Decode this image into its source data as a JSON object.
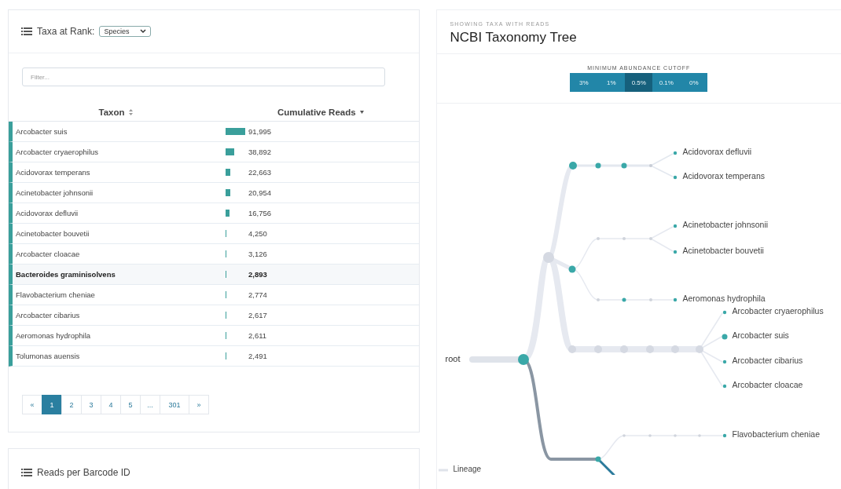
{
  "taxa_panel": {
    "title": "Taxa at Rank:",
    "rank_select": {
      "value": "Species"
    },
    "filter": {
      "placeholder": "Filter..."
    },
    "columns": [
      "Taxon",
      "Cumulative Reads"
    ],
    "rows": [
      {
        "taxon": "Arcobacter suis",
        "reads": "91,995",
        "selected": false
      },
      {
        "taxon": "Arcobacter cryaerophilus",
        "reads": "38,892",
        "selected": false
      },
      {
        "taxon": "Acidovorax temperans",
        "reads": "22,663",
        "selected": false
      },
      {
        "taxon": "Acinetobacter johnsonii",
        "reads": "20,954",
        "selected": false
      },
      {
        "taxon": "Acidovorax defluvii",
        "reads": "16,756",
        "selected": false
      },
      {
        "taxon": "Acinetobacter bouvetii",
        "reads": "4,250",
        "selected": false
      },
      {
        "taxon": "Arcobacter cloacae",
        "reads": "3,126",
        "selected": false
      },
      {
        "taxon": "Bacteroides graminisolvens",
        "reads": "2,893",
        "selected": true
      },
      {
        "taxon": "Flavobacterium cheniae",
        "reads": "2,774",
        "selected": false
      },
      {
        "taxon": "Arcobacter cibarius",
        "reads": "2,617",
        "selected": false
      },
      {
        "taxon": "Aeromonas hydrophila",
        "reads": "2,611",
        "selected": false
      },
      {
        "taxon": "Tolumonas auensis",
        "reads": "2,491",
        "selected": false
      }
    ],
    "pagination": [
      {
        "label": "«",
        "selected": false
      },
      {
        "label": "1",
        "selected": true
      },
      {
        "label": "2",
        "selected": false
      },
      {
        "label": "3",
        "selected": false
      },
      {
        "label": "4",
        "selected": false
      },
      {
        "label": "5",
        "selected": false
      },
      {
        "label": "...",
        "selected": false
      },
      {
        "label": "301",
        "selected": false
      },
      {
        "label": "»",
        "selected": false
      }
    ]
  },
  "reads_panel": {
    "title": "Reads per Barcode ID"
  },
  "tree_panel": {
    "eyebrow": "SHOWING TAXA WITH READS",
    "title": "NCBI Taxonomy Tree",
    "cutoff_label": "MINIMUM ABUNDANCE CUTOFF",
    "cutoffs": [
      {
        "label": "3%",
        "selected": false
      },
      {
        "label": "1%",
        "selected": false
      },
      {
        "label": "0.5%",
        "selected": true
      },
      {
        "label": "0.1%",
        "selected": false
      },
      {
        "label": "0%",
        "selected": false
      }
    ],
    "root_label": "root",
    "leaves": [
      "Acidovorax defluvii",
      "Acidovorax temperans",
      "Acinetobacter johnsonii",
      "Acinetobacter bouvetii",
      "Aeromonas hydrophila",
      "Arcobacter cryaerophilus",
      "Arcobacter suis",
      "Arcobacter cibarius",
      "Arcobacter cloacae",
      "Flavobacterium cheniae"
    ],
    "legend_label": "Lineage"
  }
}
